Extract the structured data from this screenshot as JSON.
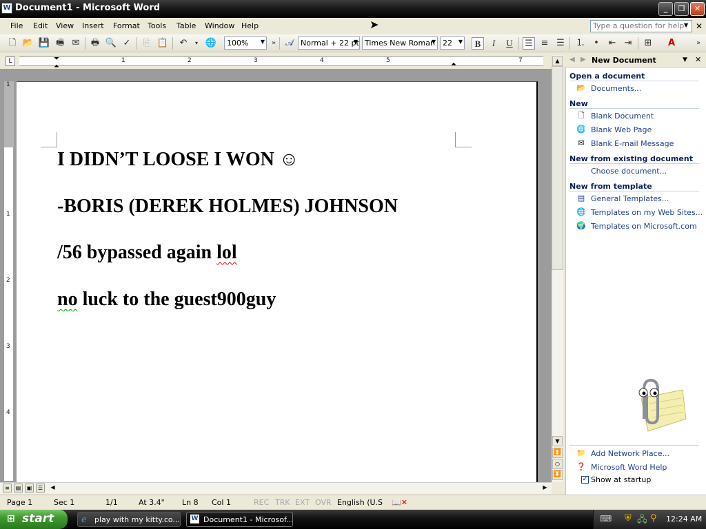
{
  "window": {
    "title": "Document1 - Microsoft Word",
    "word_icon": "W"
  },
  "menu": {
    "items": [
      "File",
      "Edit",
      "View",
      "Insert",
      "Format",
      "Tools",
      "Table",
      "Window",
      "Help"
    ],
    "help_placeholder": "Type a question for help"
  },
  "toolbar": {
    "zoom": "100%",
    "style": "Normal + 22 pt",
    "font": "Times New Roman",
    "size": "22",
    "bold": "B",
    "italic": "I",
    "underline": "U"
  },
  "ruler": {
    "numbers": [
      "1",
      "2",
      "3",
      "4",
      "5",
      "7"
    ],
    "vnumbers": [
      "1",
      "1",
      "2",
      "3",
      "4"
    ]
  },
  "document": {
    "lines": [
      "I DIDN’T LOOSE I WON ☺",
      "-BORIS (DEREK HOLMES) JOHNSON",
      "/56 bypassed again lol",
      "no luck to the guest900guy"
    ],
    "line3_pre": "/56 bypassed again ",
    "line3_err": "lol",
    "line4_err": "no",
    "line4_post": " luck to the guest900guy"
  },
  "taskpane": {
    "title": "New Document",
    "sections": {
      "open": "Open a document",
      "new": "New",
      "existing": "New from existing document",
      "template": "New from template"
    },
    "links": {
      "documents": "Documents...",
      "blank_document": "Blank Document",
      "blank_web_page": "Blank Web Page",
      "blank_email": "Blank E-mail Message",
      "choose_document": "Choose document...",
      "general_templates": "General Templates...",
      "templates_web_sites": "Templates on my Web Sites...",
      "templates_ms": "Templates on Microsoft.com",
      "add_network_place": "Add Network Place...",
      "word_help": "Microsoft Word Help",
      "show_at_startup": "Show at startup"
    },
    "show_at_startup_checked": true
  },
  "statusbar": {
    "page": "Page 1",
    "sec": "Sec 1",
    "pages": "1/1",
    "at": "At 3.4\"",
    "ln": "Ln 8",
    "col": "Col 1",
    "rec": "REC",
    "trk": "TRK",
    "ext": "EXT",
    "ovr": "OVR",
    "language": "English (U.S"
  },
  "taskbar": {
    "start": "start",
    "items": [
      "play with my kitty.co...",
      "Document1 - Microsof..."
    ],
    "clock": "12:24 AM"
  },
  "colors": {
    "link": "#1c3f94",
    "taskbar": "#1a1a1a",
    "start": "#3f9a2e"
  }
}
